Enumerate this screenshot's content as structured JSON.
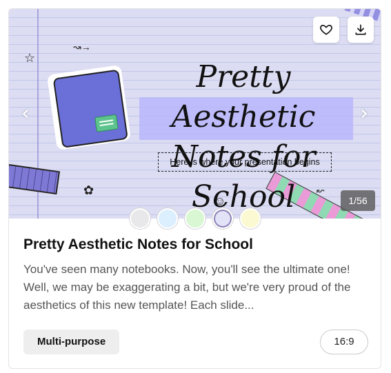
{
  "preview": {
    "slide_title": "Pretty Aesthetic Notes for School",
    "slide_subtitle": "Here is where your presentation begins",
    "counter": "1/56",
    "icons": {
      "favorite": "heart-icon",
      "download": "download-icon",
      "prev": "chevron-left-icon",
      "next": "chevron-right-icon"
    }
  },
  "swatches": [
    {
      "color": "#e8e8ea",
      "selected": false
    },
    {
      "color": "#dcefff",
      "selected": false
    },
    {
      "color": "#d9f7d3",
      "selected": false
    },
    {
      "color": "#e3e3f8",
      "selected": true
    },
    {
      "color": "#fbf9d2",
      "selected": false
    }
  ],
  "title": "Pretty Aesthetic Notes for School",
  "description": "You've seen many notebooks. Now, you'll see the ultimate one! Well, we may be exaggerating a bit, but we're very proud of the aesthetics of this new template! Each slide...",
  "tag": "Multi-purpose",
  "aspect_ratio": "16:9"
}
